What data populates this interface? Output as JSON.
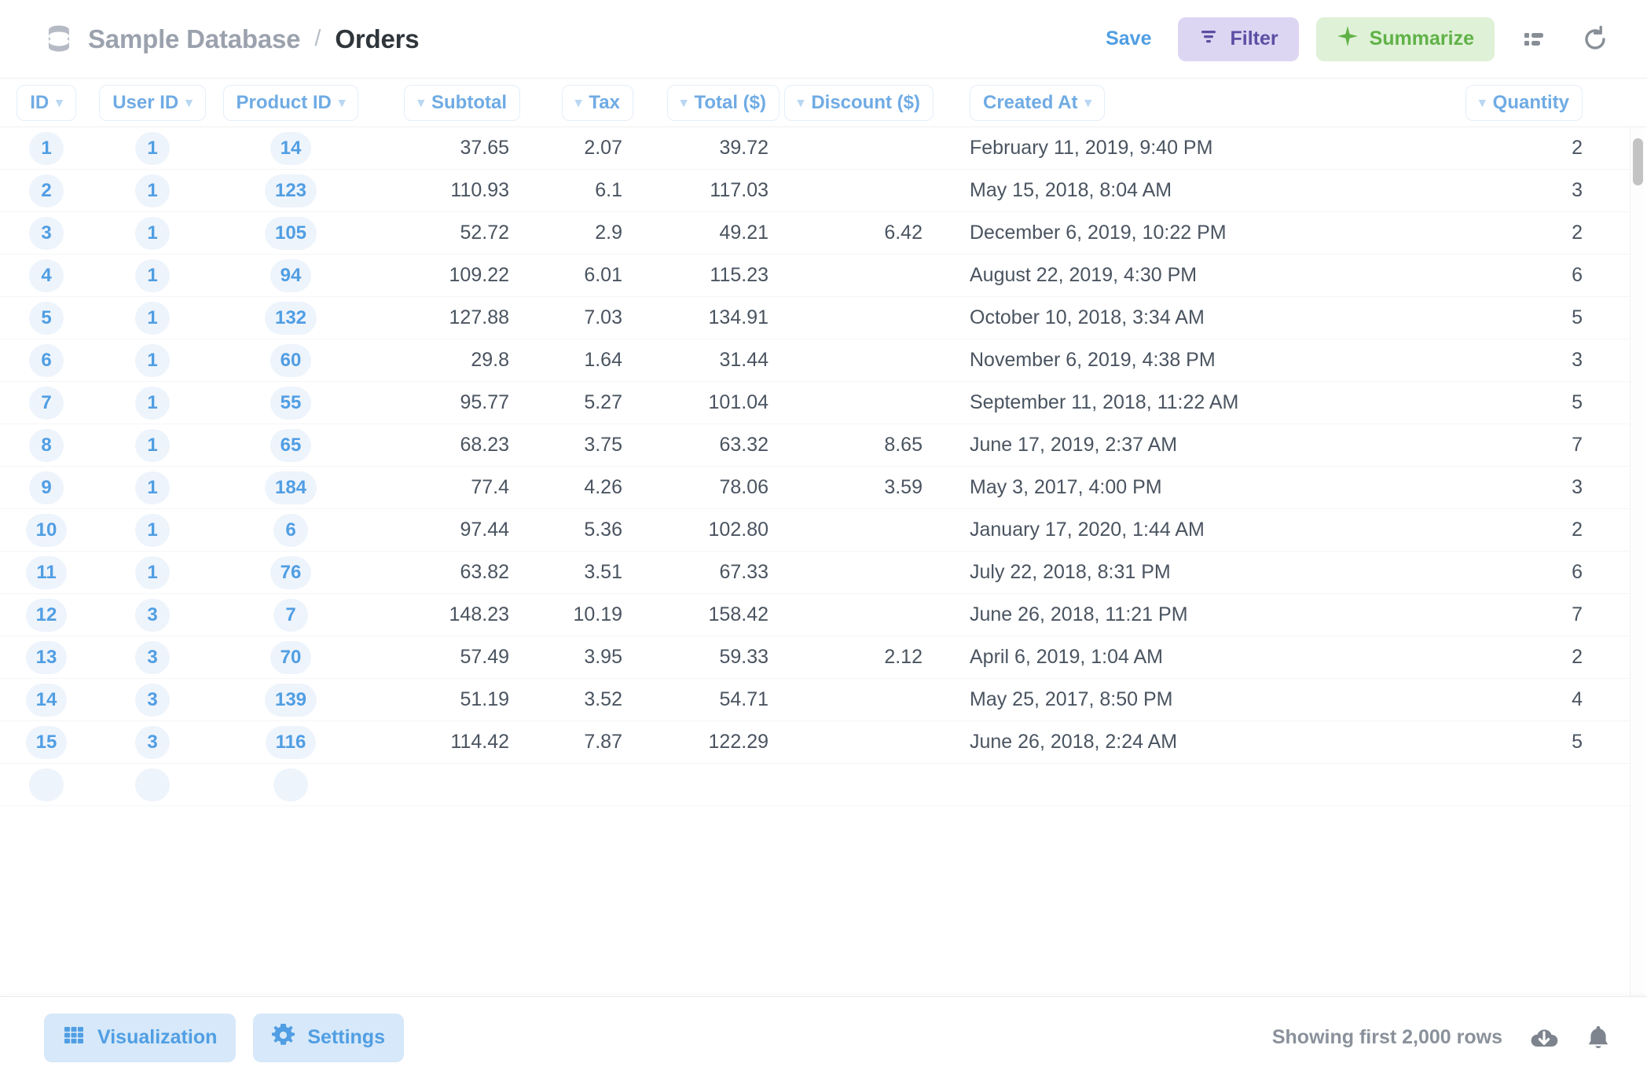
{
  "header": {
    "database": "Sample Database",
    "separator": "/",
    "table_title": "Orders",
    "save_label": "Save",
    "filter_label": "Filter",
    "summarize_label": "Summarize",
    "db_icon": "database-icon",
    "filter_icon": "filter-icon",
    "summarize_icon": "sparkle-icon",
    "list_view_icon": "list-view-icon",
    "refresh_icon": "refresh-icon",
    "accent_blue": "#509ee3",
    "filter_bg": "#ddd6f3",
    "filter_fg": "#5b4fa3",
    "summarize_bg": "#dff1d7",
    "summarize_fg": "#60b247"
  },
  "columns": [
    {
      "label": "ID",
      "chevron": "right",
      "align": "center"
    },
    {
      "label": "User ID",
      "chevron": "right",
      "align": "center"
    },
    {
      "label": "Product ID",
      "chevron": "right",
      "align": "center"
    },
    {
      "label": "Subtotal",
      "chevron": "left",
      "align": "right"
    },
    {
      "label": "Tax",
      "chevron": "left",
      "align": "right"
    },
    {
      "label": "Total ($)",
      "chevron": "left",
      "align": "right"
    },
    {
      "label": "Discount ($)",
      "chevron": "left",
      "align": "right"
    },
    {
      "label": "Created At",
      "chevron": "right",
      "align": "left"
    },
    {
      "label": "Quantity",
      "chevron": "left",
      "align": "right"
    }
  ],
  "rows": [
    {
      "id": "1",
      "user_id": "1",
      "product_id": "14",
      "subtotal": "37.65",
      "tax": "2.07",
      "total": "39.72",
      "discount": "",
      "created_at": "February 11, 2019, 9:40 PM",
      "quantity": "2"
    },
    {
      "id": "2",
      "user_id": "1",
      "product_id": "123",
      "subtotal": "110.93",
      "tax": "6.1",
      "total": "117.03",
      "discount": "",
      "created_at": "May 15, 2018, 8:04 AM",
      "quantity": "3"
    },
    {
      "id": "3",
      "user_id": "1",
      "product_id": "105",
      "subtotal": "52.72",
      "tax": "2.9",
      "total": "49.21",
      "discount": "6.42",
      "created_at": "December 6, 2019, 10:22 PM",
      "quantity": "2"
    },
    {
      "id": "4",
      "user_id": "1",
      "product_id": "94",
      "subtotal": "109.22",
      "tax": "6.01",
      "total": "115.23",
      "discount": "",
      "created_at": "August 22, 2019, 4:30 PM",
      "quantity": "6"
    },
    {
      "id": "5",
      "user_id": "1",
      "product_id": "132",
      "subtotal": "127.88",
      "tax": "7.03",
      "total": "134.91",
      "discount": "",
      "created_at": "October 10, 2018, 3:34 AM",
      "quantity": "5"
    },
    {
      "id": "6",
      "user_id": "1",
      "product_id": "60",
      "subtotal": "29.8",
      "tax": "1.64",
      "total": "31.44",
      "discount": "",
      "created_at": "November 6, 2019, 4:38 PM",
      "quantity": "3"
    },
    {
      "id": "7",
      "user_id": "1",
      "product_id": "55",
      "subtotal": "95.77",
      "tax": "5.27",
      "total": "101.04",
      "discount": "",
      "created_at": "September 11, 2018, 11:22 AM",
      "quantity": "5"
    },
    {
      "id": "8",
      "user_id": "1",
      "product_id": "65",
      "subtotal": "68.23",
      "tax": "3.75",
      "total": "63.32",
      "discount": "8.65",
      "created_at": "June 17, 2019, 2:37 AM",
      "quantity": "7"
    },
    {
      "id": "9",
      "user_id": "1",
      "product_id": "184",
      "subtotal": "77.4",
      "tax": "4.26",
      "total": "78.06",
      "discount": "3.59",
      "created_at": "May 3, 2017, 4:00 PM",
      "quantity": "3"
    },
    {
      "id": "10",
      "user_id": "1",
      "product_id": "6",
      "subtotal": "97.44",
      "tax": "5.36",
      "total": "102.80",
      "discount": "",
      "created_at": "January 17, 2020, 1:44 AM",
      "quantity": "2"
    },
    {
      "id": "11",
      "user_id": "1",
      "product_id": "76",
      "subtotal": "63.82",
      "tax": "3.51",
      "total": "67.33",
      "discount": "",
      "created_at": "July 22, 2018, 8:31 PM",
      "quantity": "6"
    },
    {
      "id": "12",
      "user_id": "3",
      "product_id": "7",
      "subtotal": "148.23",
      "tax": "10.19",
      "total": "158.42",
      "discount": "",
      "created_at": "June 26, 2018, 11:21 PM",
      "quantity": "7"
    },
    {
      "id": "13",
      "user_id": "3",
      "product_id": "70",
      "subtotal": "57.49",
      "tax": "3.95",
      "total": "59.33",
      "discount": "2.12",
      "created_at": "April 6, 2019, 1:04 AM",
      "quantity": "2"
    },
    {
      "id": "14",
      "user_id": "3",
      "product_id": "139",
      "subtotal": "51.19",
      "tax": "3.52",
      "total": "54.71",
      "discount": "",
      "created_at": "May 25, 2017, 8:50 PM",
      "quantity": "4"
    },
    {
      "id": "15",
      "user_id": "3",
      "product_id": "116",
      "subtotal": "114.42",
      "tax": "7.87",
      "total": "122.29",
      "discount": "",
      "created_at": "June 26, 2018, 2:24 AM",
      "quantity": "5"
    }
  ],
  "footer": {
    "visualization_label": "Visualization",
    "settings_label": "Settings",
    "rows_status": "Showing first 2,000 rows",
    "visualization_icon": "grid-icon",
    "settings_icon": "gear-icon",
    "download_icon": "download-cloud-icon",
    "alert_icon": "bell-icon"
  }
}
